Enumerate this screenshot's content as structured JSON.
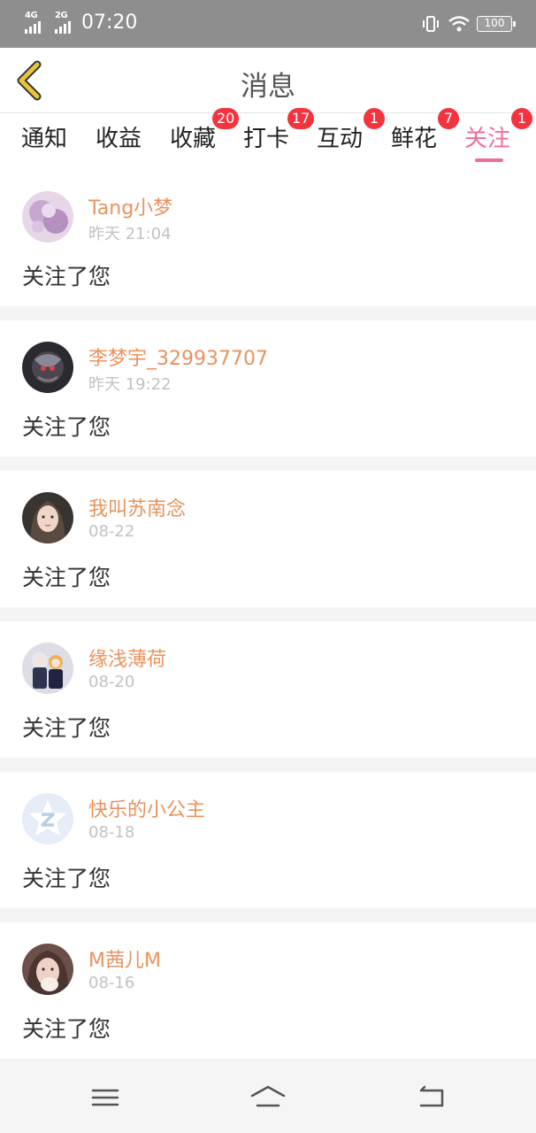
{
  "status_bar": {
    "net1": "4G",
    "net2": "2G",
    "time": "07:20",
    "battery": "100"
  },
  "header": {
    "title": "消息"
  },
  "tabs": [
    {
      "label": "通知",
      "badge": ""
    },
    {
      "label": "收益",
      "badge": ""
    },
    {
      "label": "收藏",
      "badge": "20"
    },
    {
      "label": "打卡",
      "badge": "17"
    },
    {
      "label": "互动",
      "badge": "1"
    },
    {
      "label": "鲜花",
      "badge": "7"
    },
    {
      "label": "关注",
      "badge": "1",
      "active": true
    }
  ],
  "messages": [
    {
      "name": "Tang小梦",
      "time": "昨天 21:04",
      "text": "关注了您",
      "avatar": "purple-floral-avatar"
    },
    {
      "name": "李梦宇_329937707",
      "time": "昨天 19:22",
      "text": "关注了您",
      "avatar": "dark-game-avatar"
    },
    {
      "name": "我叫苏南念",
      "time": "08-22",
      "text": "关注了您",
      "avatar": "girl-portrait-avatar"
    },
    {
      "name": "缘浅薄荷",
      "time": "08-20",
      "text": "关注了您",
      "avatar": "anime-characters-avatar"
    },
    {
      "name": "快乐的小公主",
      "time": "08-18",
      "text": "关注了您",
      "avatar": "default-star-avatar"
    },
    {
      "name": "M茜儿M",
      "time": "08-16",
      "text": "关注了您",
      "avatar": "girl-selfie-avatar"
    }
  ],
  "colors": {
    "accent": "#f06ba0",
    "badge": "#f5333f",
    "username": "#e9925d",
    "back_icon": "#e8c53a"
  },
  "nav": {
    "icons": [
      "menu-icon",
      "home-icon",
      "back-icon"
    ]
  }
}
